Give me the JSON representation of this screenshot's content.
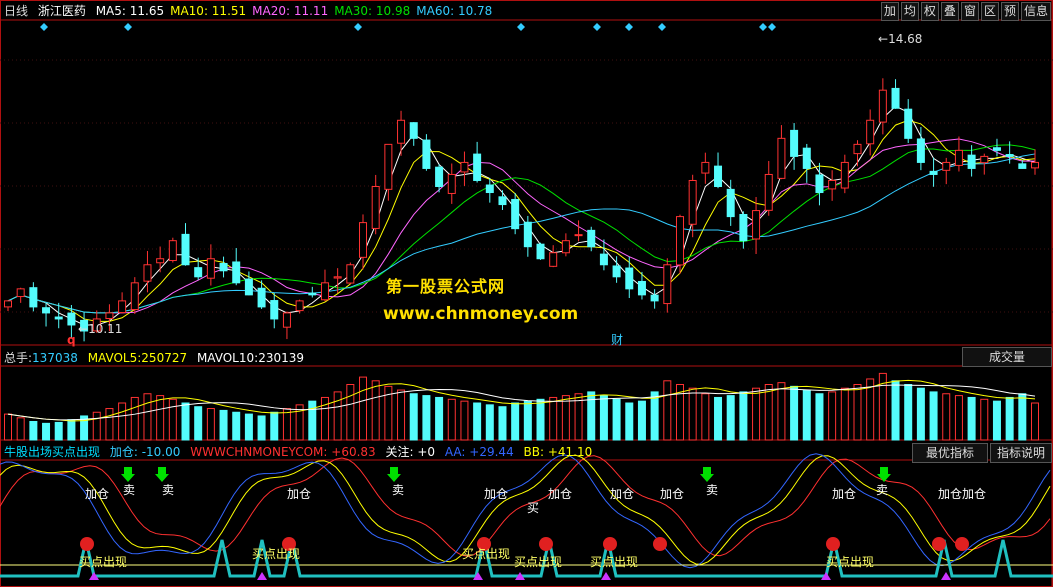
{
  "header": {
    "period": "日线",
    "stock_name": "浙江医药",
    "ma": [
      {
        "label": "MA5:",
        "value": "11.65",
        "color": "#ffffff"
      },
      {
        "label": "MA10:",
        "value": "11.51",
        "color": "#ffff00"
      },
      {
        "label": "MA20:",
        "value": "11.11",
        "color": "#ff66ff"
      },
      {
        "label": "MA30:",
        "value": "10.98",
        "color": "#00e000"
      },
      {
        "label": "MA60:",
        "value": "10.78",
        "color": "#33ccff"
      }
    ]
  },
  "toolbar": [
    "加",
    "均",
    "权",
    "叠",
    "窗",
    "区",
    "预",
    "信息"
  ],
  "price_panel": {
    "high_label": "14.68",
    "low_label": "10.11",
    "marker_q": "q",
    "marker_cai": "财",
    "watermark_cn": "第一股票公式网",
    "watermark_url": "www.chnmoney.com"
  },
  "volume_panel": {
    "total_label": "总手:",
    "total_value": "137038",
    "mavol5_label": "MAVOL5:",
    "mavol5_value": "250727",
    "mavol10_label": "MAVOL10:",
    "mavol10_value": "230139",
    "button": "成交量"
  },
  "indicator_panel": {
    "name": "牛股出场买点出现",
    "jiacang": "加仓: -10.00",
    "site": "WWWCHNMONEYCOM: +60.83",
    "guanzhu": "关注: +0",
    "aa": "AA: +29.44",
    "bb": "BB: +41.10",
    "btn_best": "最优指标",
    "btn_desc": "指标说明",
    "labels": {
      "add": "加仓",
      "sell": "卖",
      "buy": "买",
      "buy_point": "买点出现"
    }
  },
  "colors": {
    "up": "#ff3232",
    "down": "#54fcfc",
    "ma5": "#ffffff",
    "ma10": "#ffff00",
    "ma20": "#ff66ff",
    "ma30": "#00e000",
    "ma60": "#33ccff",
    "border": "#b01010"
  },
  "chart_data": [
    {
      "type": "candlestick",
      "title": "浙江医药 日线",
      "ylim": [
        10.0,
        15.0
      ],
      "annotations": [
        {
          "label": "14.68",
          "value": 14.68
        },
        {
          "label": "10.11",
          "value": 10.11
        }
      ],
      "close": [
        10.6,
        10.8,
        10.5,
        10.4,
        10.3,
        10.2,
        10.1,
        10.3,
        10.4,
        10.6,
        10.9,
        11.2,
        11.3,
        11.6,
        11.2,
        11.0,
        11.3,
        11.1,
        10.9,
        10.7,
        10.5,
        10.3,
        10.4,
        10.6,
        10.7,
        10.9,
        11.0,
        11.2,
        11.9,
        12.5,
        13.2,
        13.6,
        13.3,
        12.8,
        12.5,
        12.7,
        12.9,
        12.6,
        12.4,
        12.2,
        11.8,
        11.5,
        11.3,
        11.4,
        11.6,
        11.7,
        11.5,
        11.2,
        11.0,
        10.8,
        10.7,
        10.6,
        11.2,
        12.0,
        12.6,
        12.9,
        12.5,
        12.0,
        11.6,
        12.1,
        12.7,
        13.3,
        13.0,
        12.8,
        12.4,
        12.6,
        12.9,
        13.2,
        13.6,
        14.1,
        13.8,
        13.3,
        12.9,
        12.7,
        12.9,
        13.1,
        12.8,
        13.0,
        13.1,
        13.0,
        12.8,
        12.9
      ],
      "volume": [
        140,
        120,
        100,
        90,
        95,
        110,
        130,
        150,
        170,
        200,
        230,
        250,
        240,
        220,
        200,
        180,
        170,
        160,
        150,
        140,
        130,
        150,
        170,
        190,
        210,
        230,
        260,
        300,
        340,
        320,
        290,
        270,
        250,
        240,
        230,
        220,
        210,
        200,
        190,
        180,
        200,
        210,
        220,
        230,
        240,
        250,
        260,
        240,
        220,
        200,
        210,
        260,
        320,
        300,
        280,
        250,
        230,
        240,
        260,
        280,
        300,
        310,
        290,
        270,
        250,
        260,
        280,
        300,
        330,
        360,
        320,
        300,
        280,
        260,
        250,
        240,
        230,
        220,
        210,
        230,
        250,
        200
      ]
    }
  ]
}
